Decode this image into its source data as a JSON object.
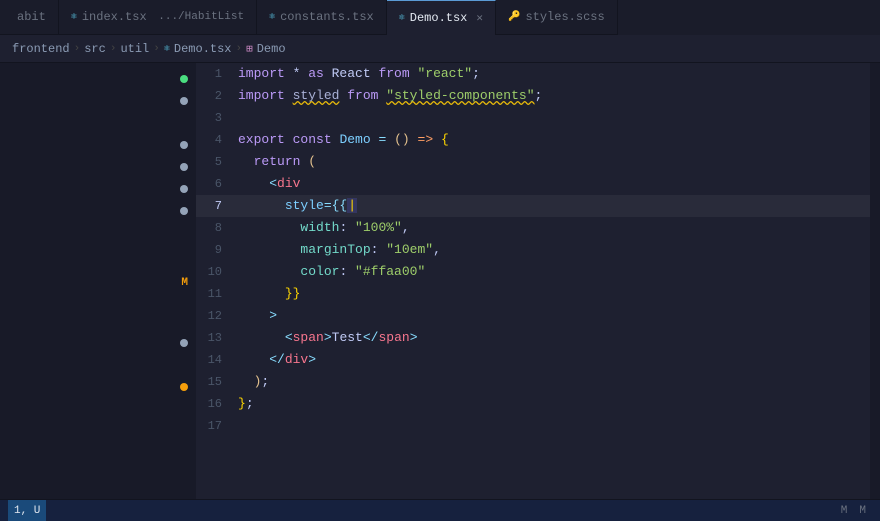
{
  "tabs": [
    {
      "id": "habit",
      "label": "abit",
      "icon": "",
      "iconClass": "",
      "active": false,
      "closeable": false
    },
    {
      "id": "index-tsx",
      "label": "index.tsx",
      "sublabel": ".../HabitList",
      "icon": "⚛",
      "iconClass": "tab-icon-react",
      "active": false,
      "closeable": false
    },
    {
      "id": "constants-tsx",
      "label": "constants.tsx",
      "icon": "⚛",
      "iconClass": "tab-icon-react",
      "active": false,
      "closeable": false
    },
    {
      "id": "demo-tsx",
      "label": "Demo.tsx",
      "icon": "⚛",
      "iconClass": "tab-icon-react",
      "active": true,
      "closeable": true
    },
    {
      "id": "styles-scss",
      "label": "styles.scss",
      "icon": "🔑",
      "iconClass": "tab-icon-key",
      "active": false,
      "closeable": false
    }
  ],
  "breadcrumb": {
    "items": [
      {
        "label": "frontend",
        "type": "folder"
      },
      {
        "label": "src",
        "type": "folder"
      },
      {
        "label": "util",
        "type": "folder"
      },
      {
        "label": "Demo.tsx",
        "type": "react-file"
      },
      {
        "label": "Demo",
        "type": "component"
      }
    ]
  },
  "lines": [
    {
      "num": 1,
      "code": "import * as React from \"react\";"
    },
    {
      "num": 2,
      "code": "import styled from \"styled-components\";"
    },
    {
      "num": 3,
      "code": ""
    },
    {
      "num": 4,
      "code": "export const Demo = () => {"
    },
    {
      "num": 5,
      "code": "  return ("
    },
    {
      "num": 6,
      "code": "    <div"
    },
    {
      "num": 7,
      "code": "      style={{"
    },
    {
      "num": 8,
      "code": "        width: \"100%\","
    },
    {
      "num": 9,
      "code": "        marginTop: \"10em\","
    },
    {
      "num": 10,
      "code": "        color: \"#ffaa00\""
    },
    {
      "num": 11,
      "code": "      }}"
    },
    {
      "num": 12,
      "code": "    >"
    },
    {
      "num": 13,
      "code": "      <span>Test</span>"
    },
    {
      "num": 14,
      "code": "    </div>"
    },
    {
      "num": 15,
      "code": "  );"
    },
    {
      "num": 16,
      "code": "};"
    },
    {
      "num": 17,
      "code": ""
    }
  ],
  "gutter_items": [
    {
      "type": "dot",
      "color": "#4ade80",
      "line": 1
    },
    {
      "type": "dot",
      "color": "#94a3b8",
      "line": 2
    },
    {
      "type": "empty",
      "line": 3
    },
    {
      "type": "dot",
      "color": "#94a3b8",
      "line": 4
    },
    {
      "type": "dot",
      "color": "#94a3b8",
      "line": 5
    },
    {
      "type": "dot",
      "color": "#94a3b8",
      "line": 6
    },
    {
      "type": "dot",
      "color": "#94a3b8",
      "line": 7
    },
    {
      "type": "empty",
      "line": 8
    },
    {
      "type": "empty",
      "line": 9
    },
    {
      "type": "m",
      "line": 10
    },
    {
      "type": "empty",
      "line": 11
    },
    {
      "type": "empty",
      "line": 12
    },
    {
      "type": "dot",
      "color": "#94a3b8",
      "line": 13
    },
    {
      "type": "empty",
      "line": 14
    },
    {
      "type": "dot",
      "color": "#f59e0b",
      "line": 15
    },
    {
      "type": "empty",
      "line": 16
    },
    {
      "type": "empty",
      "line": 17
    }
  ],
  "status_bar": {
    "position": "1, U",
    "items_right": [
      "M",
      "M"
    ]
  }
}
